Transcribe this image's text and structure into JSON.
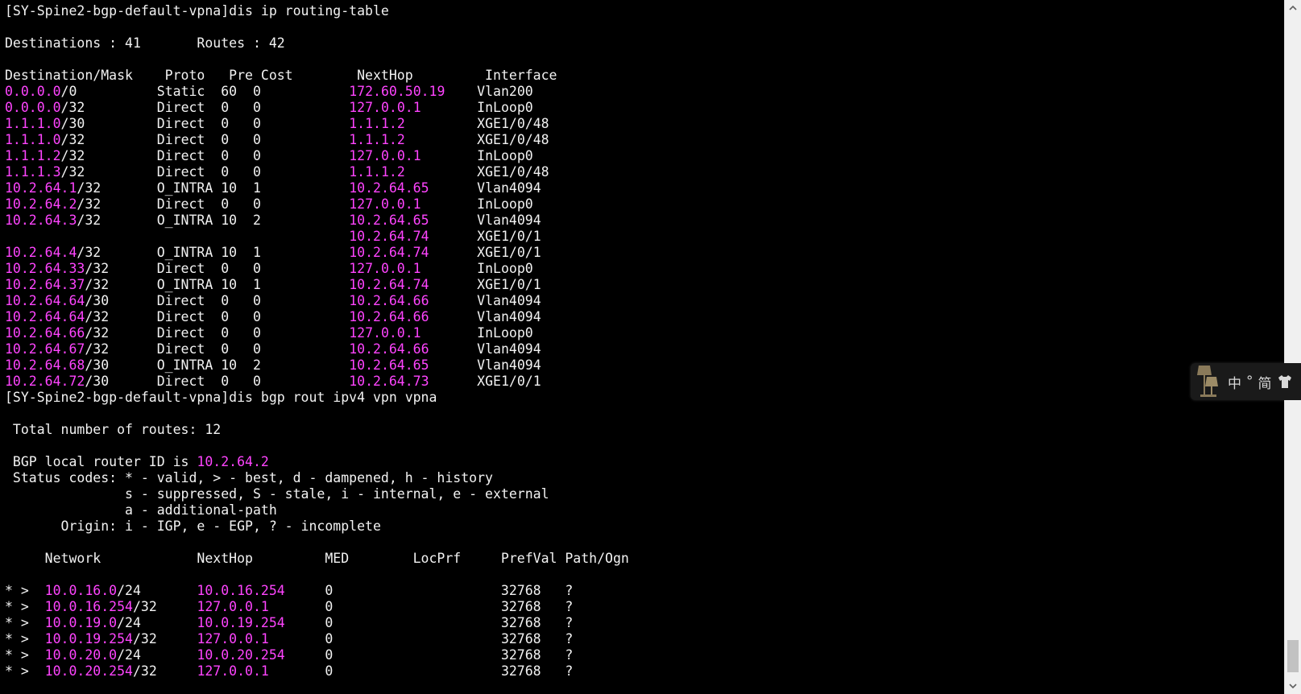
{
  "prompt": "[SY-Spine2-bgp-default-vpna]",
  "commands": {
    "cmd1": "dis ip routing-table",
    "cmd2": "dis bgp rout ipv4 vpn vpna"
  },
  "routing_table": {
    "summary": "Destinations : 41       Routes : 42",
    "header": "Destination/Mask    Proto   Pre Cost        NextHop         Interface",
    "rows": [
      {
        "dest": "0.0.0.0",
        "mask": "/0",
        "proto": "Static",
        "pre": "60",
        "cost": "0",
        "nexthop": "172.60.50.19",
        "iface": "Vlan200"
      },
      {
        "dest": "0.0.0.0",
        "mask": "/32",
        "proto": "Direct",
        "pre": "0",
        "cost": "0",
        "nexthop": "127.0.0.1",
        "iface": "InLoop0"
      },
      {
        "dest": "1.1.1.0",
        "mask": "/30",
        "proto": "Direct",
        "pre": "0",
        "cost": "0",
        "nexthop": "1.1.1.2",
        "iface": "XGE1/0/48"
      },
      {
        "dest": "1.1.1.0",
        "mask": "/32",
        "proto": "Direct",
        "pre": "0",
        "cost": "0",
        "nexthop": "1.1.1.2",
        "iface": "XGE1/0/48"
      },
      {
        "dest": "1.1.1.2",
        "mask": "/32",
        "proto": "Direct",
        "pre": "0",
        "cost": "0",
        "nexthop": "127.0.0.1",
        "iface": "InLoop0"
      },
      {
        "dest": "1.1.1.3",
        "mask": "/32",
        "proto": "Direct",
        "pre": "0",
        "cost": "0",
        "nexthop": "1.1.1.2",
        "iface": "XGE1/0/48"
      },
      {
        "dest": "10.2.64.1",
        "mask": "/32",
        "proto": "O_INTRA",
        "pre": "10",
        "cost": "1",
        "nexthop": "10.2.64.65",
        "iface": "Vlan4094"
      },
      {
        "dest": "10.2.64.2",
        "mask": "/32",
        "proto": "Direct",
        "pre": "0",
        "cost": "0",
        "nexthop": "127.0.0.1",
        "iface": "InLoop0"
      },
      {
        "dest": "10.2.64.3",
        "mask": "/32",
        "proto": "O_INTRA",
        "pre": "10",
        "cost": "2",
        "nexthop": "10.2.64.65",
        "iface": "Vlan4094"
      },
      {
        "dest": "",
        "mask": "",
        "proto": "",
        "pre": "",
        "cost": "",
        "nexthop": "10.2.64.74",
        "iface": "XGE1/0/1"
      },
      {
        "dest": "10.2.64.4",
        "mask": "/32",
        "proto": "O_INTRA",
        "pre": "10",
        "cost": "1",
        "nexthop": "10.2.64.74",
        "iface": "XGE1/0/1"
      },
      {
        "dest": "10.2.64.33",
        "mask": "/32",
        "proto": "Direct",
        "pre": "0",
        "cost": "0",
        "nexthop": "127.0.0.1",
        "iface": "InLoop0"
      },
      {
        "dest": "10.2.64.37",
        "mask": "/32",
        "proto": "O_INTRA",
        "pre": "10",
        "cost": "1",
        "nexthop": "10.2.64.74",
        "iface": "XGE1/0/1"
      },
      {
        "dest": "10.2.64.64",
        "mask": "/30",
        "proto": "Direct",
        "pre": "0",
        "cost": "0",
        "nexthop": "10.2.64.66",
        "iface": "Vlan4094"
      },
      {
        "dest": "10.2.64.64",
        "mask": "/32",
        "proto": "Direct",
        "pre": "0",
        "cost": "0",
        "nexthop": "10.2.64.66",
        "iface": "Vlan4094"
      },
      {
        "dest": "10.2.64.66",
        "mask": "/32",
        "proto": "Direct",
        "pre": "0",
        "cost": "0",
        "nexthop": "127.0.0.1",
        "iface": "InLoop0"
      },
      {
        "dest": "10.2.64.67",
        "mask": "/32",
        "proto": "Direct",
        "pre": "0",
        "cost": "0",
        "nexthop": "10.2.64.66",
        "iface": "Vlan4094"
      },
      {
        "dest": "10.2.64.68",
        "mask": "/30",
        "proto": "O_INTRA",
        "pre": "10",
        "cost": "2",
        "nexthop": "10.2.64.65",
        "iface": "Vlan4094"
      },
      {
        "dest": "10.2.64.72",
        "mask": "/30",
        "proto": "Direct",
        "pre": "0",
        "cost": "0",
        "nexthop": "10.2.64.73",
        "iface": "XGE1/0/1"
      }
    ]
  },
  "bgp": {
    "total": " Total number of routes: 12",
    "router_id_label": " BGP local router ID is ",
    "router_id": "10.2.64.2",
    "status_lines": [
      " Status codes: * - valid, > - best, d - dampened, h - history",
      "               s - suppressed, S - stale, i - internal, e - external",
      "               a - additional-path",
      "       Origin: i - IGP, e - EGP, ? - incomplete"
    ],
    "header": "     Network            NextHop         MED        LocPrf     PrefVal Path/Ogn",
    "rows": [
      {
        "status": "* >",
        "net": "10.0.16.0",
        "mask": "/24",
        "nexthop": "10.0.16.254",
        "med": "0",
        "prefval": "32768",
        "path": "?"
      },
      {
        "status": "* >",
        "net": "10.0.16.254",
        "mask": "/32",
        "nexthop": "127.0.0.1",
        "med": "0",
        "prefval": "32768",
        "path": "?"
      },
      {
        "status": "* >",
        "net": "10.0.19.0",
        "mask": "/24",
        "nexthop": "10.0.19.254",
        "med": "0",
        "prefval": "32768",
        "path": "?"
      },
      {
        "status": "* >",
        "net": "10.0.19.254",
        "mask": "/32",
        "nexthop": "127.0.0.1",
        "med": "0",
        "prefval": "32768",
        "path": "?"
      },
      {
        "status": "* >",
        "net": "10.0.20.0",
        "mask": "/24",
        "nexthop": "10.0.20.254",
        "med": "0",
        "prefval": "32768",
        "path": "?"
      },
      {
        "status": "* >",
        "net": "10.0.20.254",
        "mask": "/32",
        "nexthop": "127.0.0.1",
        "med": "0",
        "prefval": "32768",
        "path": "?"
      }
    ]
  },
  "ime_toolbar": {
    "lang": "中",
    "punct": "°",
    "mode": "简",
    "lamp_icon": "lamp-icon",
    "skin_icon": "shirt-icon"
  },
  "colors": {
    "background": "#000000",
    "text": "#f2f2f2",
    "ip_highlight": "#ff44ff"
  }
}
